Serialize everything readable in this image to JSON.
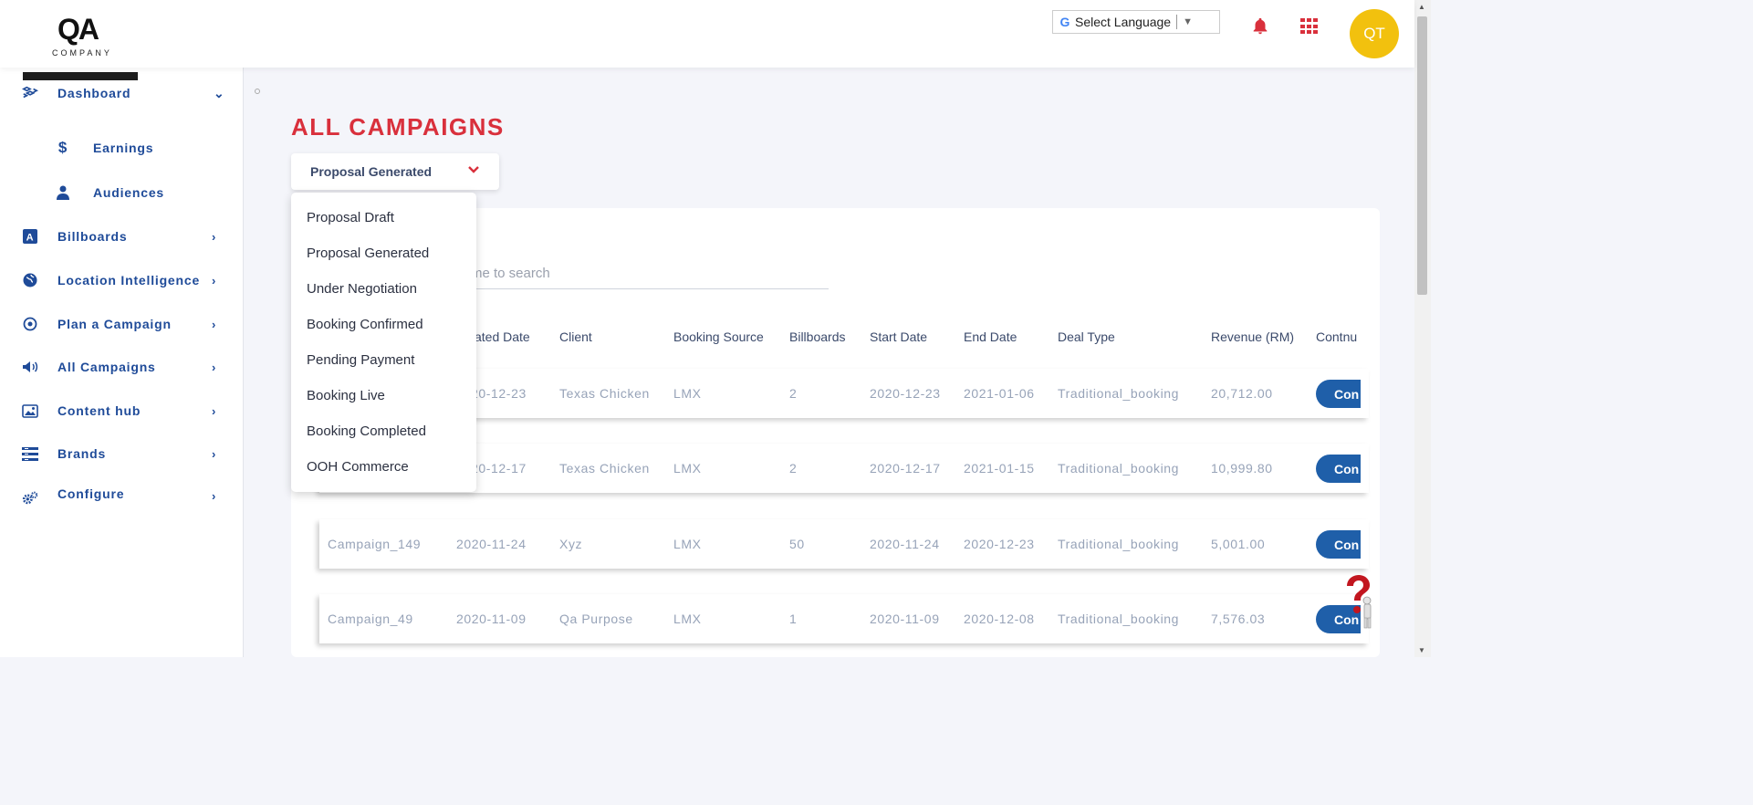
{
  "header": {
    "logo_text": "QA",
    "logo_subtext": "COMPANY",
    "language_select": "Select Language",
    "user_initials": "QT"
  },
  "sidebar": {
    "items": [
      {
        "label": "Dashboard",
        "icon": "dashboard-icon"
      },
      {
        "label": "Earnings",
        "icon": "dollar-icon"
      },
      {
        "label": "Audiences",
        "icon": "user-icon"
      },
      {
        "label": "Billboards",
        "icon": "billboard-icon"
      },
      {
        "label": "Location Intelligence",
        "icon": "globe-icon"
      },
      {
        "label": "Plan a Campaign",
        "icon": "target-icon"
      },
      {
        "label": "All Campaigns",
        "icon": "megaphone-icon"
      },
      {
        "label": "Content hub",
        "icon": "image-icon"
      },
      {
        "label": "Brands",
        "icon": "brands-icon"
      },
      {
        "label": "Configure",
        "icon": "gears-icon"
      }
    ]
  },
  "main": {
    "title": "ALL CAMPAIGNS",
    "status_selected": "Proposal Generated",
    "status_options": [
      "Proposal Draft",
      "Proposal Generated",
      "Under Negotiation",
      "Booking Confirmed",
      "Pending Payment",
      "Booking Live",
      "Booking Completed",
      "OOH Commerce"
    ],
    "search_placeholder": "me to search",
    "columns": [
      "ated Date",
      "Client",
      "Booking Source",
      "Billboards",
      "Start Date",
      "End Date",
      "Deal Type",
      "Revenue (RM)",
      "Contnu"
    ],
    "rows": [
      {
        "name": "",
        "created": "20-12-23",
        "client": "Texas Chicken",
        "source": "LMX",
        "billboards": "2",
        "start": "2020-12-23",
        "end": "2021-01-06",
        "deal": "Traditional_booking",
        "revenue": "20,712.00",
        "action": "Con"
      },
      {
        "name": "",
        "created": "20-12-17",
        "client": "Texas Chicken",
        "source": "LMX",
        "billboards": "2",
        "start": "2020-12-17",
        "end": "2021-01-15",
        "deal": "Traditional_booking",
        "revenue": "10,999.80",
        "action": "Con"
      },
      {
        "name": "Campaign_149",
        "created": "2020-11-24",
        "client": "Xyz",
        "source": "LMX",
        "billboards": "50",
        "start": "2020-11-24",
        "end": "2020-12-23",
        "deal": "Traditional_booking",
        "revenue": "5,001.00",
        "action": "Con"
      },
      {
        "name": "Campaign_49",
        "created": "2020-11-09",
        "client": "Qa Purpose",
        "source": "LMX",
        "billboards": "1",
        "start": "2020-11-09",
        "end": "2020-12-08",
        "deal": "Traditional_booking",
        "revenue": "7,576.03",
        "action": "Con"
      }
    ]
  },
  "colors": {
    "accent_red": "#d9303c",
    "nav_blue": "#1f4b99",
    "button_blue": "#1f5fa9",
    "avatar_yellow": "#f2c10e"
  }
}
